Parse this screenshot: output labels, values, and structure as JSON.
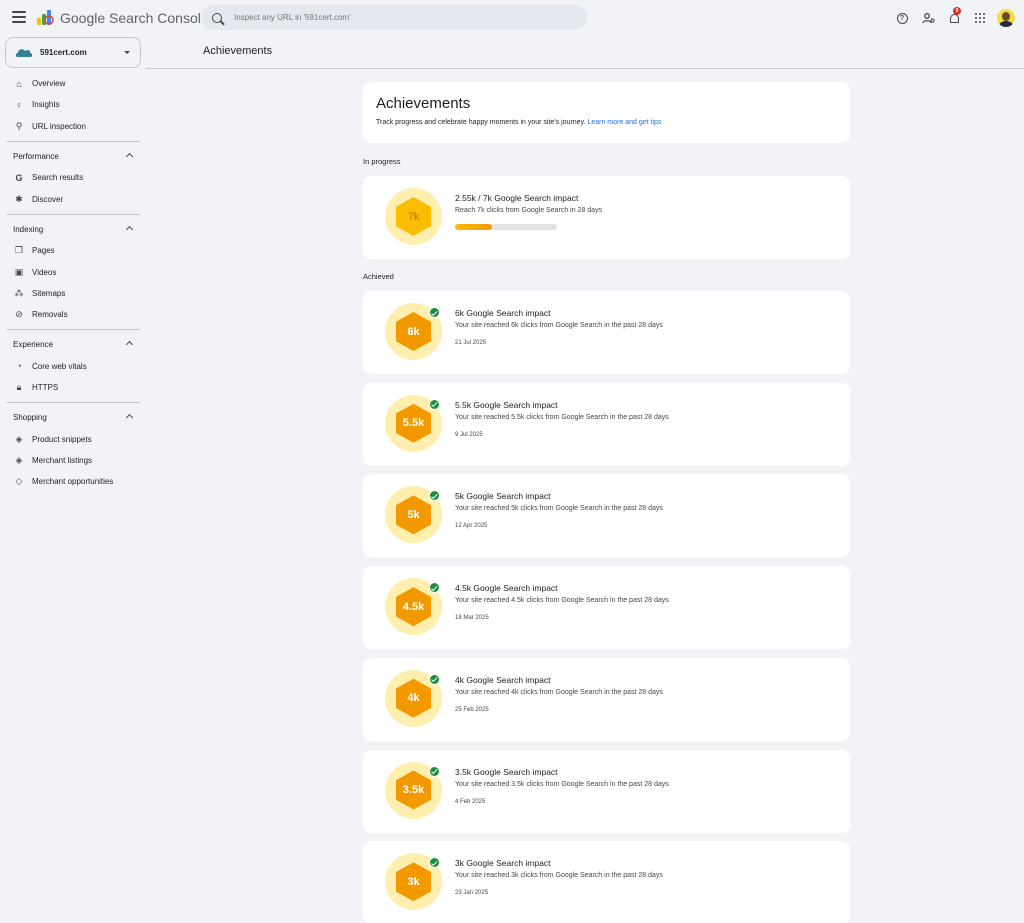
{
  "app": {
    "product_name": "Google Search Console"
  },
  "search": {
    "placeholder": "Inspect any URL in '591cert.com'"
  },
  "topbar": {
    "notification_count": "9"
  },
  "property": {
    "name": "591cert.com"
  },
  "sidebar": {
    "top_items": [
      {
        "label": "Overview",
        "icon": "home-icon"
      },
      {
        "label": "Insights",
        "icon": "lightbulb-icon"
      },
      {
        "label": "URL inspection",
        "icon": "search-icon"
      }
    ],
    "sections": [
      {
        "title": "Performance",
        "items": [
          {
            "label": "Search results",
            "icon": "google-g-icon"
          },
          {
            "label": "Discover",
            "icon": "asterisk-icon"
          }
        ]
      },
      {
        "title": "Indexing",
        "items": [
          {
            "label": "Pages",
            "icon": "pages-icon"
          },
          {
            "label": "Videos",
            "icon": "video-icon"
          },
          {
            "label": "Sitemaps",
            "icon": "sitemap-icon"
          },
          {
            "label": "Removals",
            "icon": "eye-off-icon"
          }
        ]
      },
      {
        "title": "Experience",
        "items": [
          {
            "label": "Core web vitals",
            "icon": "gauge-icon"
          },
          {
            "label": "HTTPS",
            "icon": "lock-icon"
          }
        ]
      },
      {
        "title": "Shopping",
        "items": [
          {
            "label": "Product snippets",
            "icon": "layers-icon"
          },
          {
            "label": "Merchant listings",
            "icon": "layers-icon"
          },
          {
            "label": "Merchant opportunities",
            "icon": "tag-icon"
          }
        ]
      }
    ]
  },
  "page": {
    "title": "Achievements",
    "intro_title": "Achievements",
    "intro_text": "Track progress and celebrate happy moments in your site's journey.",
    "intro_link": "Learn more and get tips",
    "in_progress_label": "In progress",
    "achieved_label": "Achieved"
  },
  "in_progress": {
    "badge": "7k",
    "title": "2.55k / 7k Google Search impact",
    "desc": "Reach 7k clicks from Google Search in 28 days",
    "progress": 0.364
  },
  "achievements": [
    {
      "badge": "6k",
      "title": "6k Google Search impact",
      "desc": "Your site reached 6k clicks from Google Search in the past 28 days",
      "date": "21 Jul 2025"
    },
    {
      "badge": "5.5k",
      "title": "5.5k Google Search impact",
      "desc": "Your site reached 5.5k clicks from Google Search in the past 28 days",
      "date": "9 Jul 2025"
    },
    {
      "badge": "5k",
      "title": "5k Google Search impact",
      "desc": "Your site reached 5k clicks from Google Search in the past 28 days",
      "date": "12 Apr 2025"
    },
    {
      "badge": "4.5k",
      "title": "4.5k Google Search impact",
      "desc": "Your site reached 4.5k clicks from Google Search in the past 28 days",
      "date": "18 Mar 2025"
    },
    {
      "badge": "4k",
      "title": "4k Google Search impact",
      "desc": "Your site reached 4k clicks from Google Search in the past 28 days",
      "date": "25 Feb 2025"
    },
    {
      "badge": "3.5k",
      "title": "3.5k Google Search impact",
      "desc": "Your site reached 3.5k clicks from Google Search in the past 28 days",
      "date": "4 Feb 2025"
    },
    {
      "badge": "3k",
      "title": "3k Google Search impact",
      "desc": "Your site reached 3k clicks from Google Search in the past 28 days",
      "date": "23 Jan 2025"
    }
  ],
  "colors": {
    "accent": "#1a73e8",
    "badge_orange": "#f29900",
    "badge_yellow": "#fbbc04",
    "badge_ring": "#feefae",
    "check_green": "#1e8e3e"
  }
}
